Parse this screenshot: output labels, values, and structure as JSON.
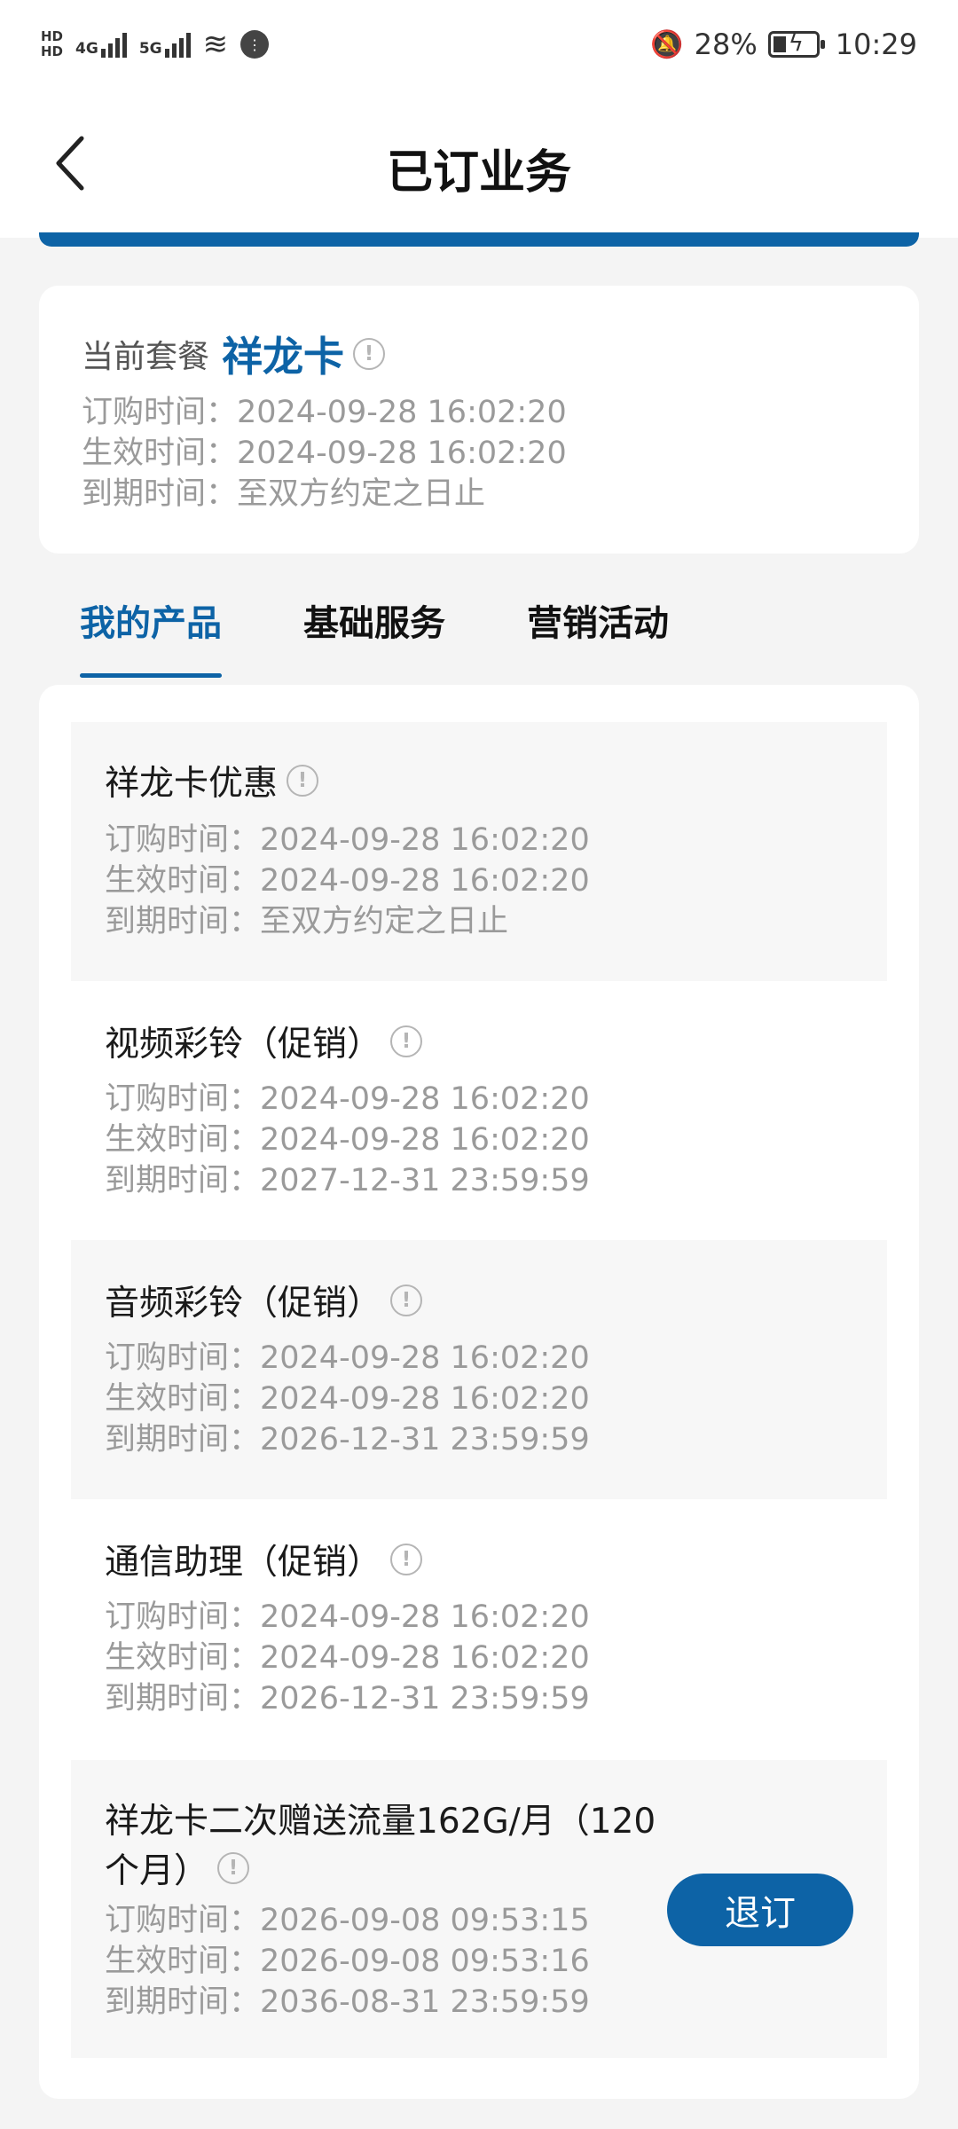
{
  "status_bar": {
    "hd1": "HD",
    "hd2": "HD",
    "net1": "4G",
    "net2": "5G",
    "battery_percent": "28%",
    "time": "10:29"
  },
  "header": {
    "title": "已订业务"
  },
  "plan": {
    "label": "当前套餐",
    "name": "祥龙卡",
    "lines": [
      "订购时间：2024-09-28 16:02:20",
      "生效时间：2024-09-28 16:02:20",
      "到期时间：至双方约定之日止"
    ]
  },
  "tabs": [
    {
      "label": "我的产品",
      "active": true
    },
    {
      "label": "基础服务",
      "active": false
    },
    {
      "label": "营销活动",
      "active": false
    }
  ],
  "products": [
    {
      "name": "祥龙卡优惠",
      "lines": [
        "订购时间：2024-09-28 16:02:20",
        "生效时间：2024-09-28 16:02:20",
        "到期时间：至双方约定之日止"
      ]
    },
    {
      "name": "视频彩铃（促销）",
      "lines": [
        "订购时间：2024-09-28 16:02:20",
        "生效时间：2024-09-28 16:02:20",
        "到期时间：2027-12-31 23:59:59"
      ]
    },
    {
      "name": "音频彩铃（促销）",
      "lines": [
        "订购时间：2024-09-28 16:02:20",
        "生效时间：2024-09-28 16:02:20",
        "到期时间：2026-12-31 23:59:59"
      ]
    },
    {
      "name": "通信助理（促销）",
      "lines": [
        "订购时间：2024-09-28 16:02:20",
        "生效时间：2024-09-28 16:02:20",
        "到期时间：2026-12-31 23:59:59"
      ]
    },
    {
      "name_line1": "祥龙卡二次赠送流量162G/月（120",
      "name_line2": "个月）",
      "lines": [
        "订购时间：2026-09-08 09:53:15",
        "生效时间：2026-09-08 09:53:16",
        "到期时间：2036-08-31 23:59:59"
      ],
      "action_label": "退订"
    }
  ],
  "colors": {
    "accent": "#0d63a6",
    "muted_text": "#9a9a9a",
    "background": "#f4f4f4"
  },
  "icons": [
    "back-arrow-icon",
    "info-icon",
    "bell-muted-icon",
    "battery-icon",
    "wifi-icon",
    "signal-icon"
  ]
}
